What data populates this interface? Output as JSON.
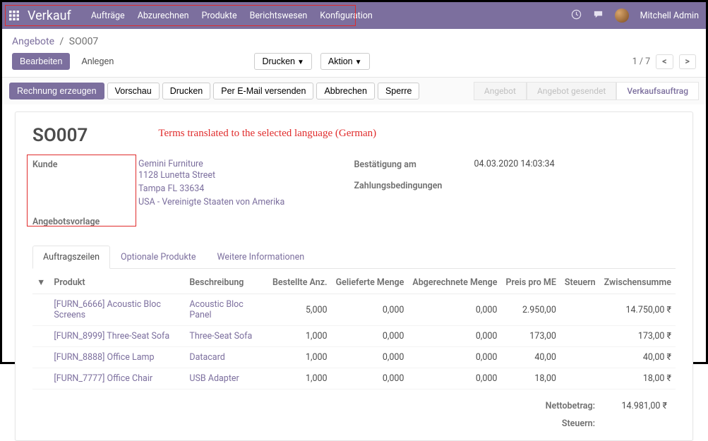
{
  "topbar": {
    "brand": "Verkauf",
    "nav": [
      "Aufträge",
      "Abzurechnen",
      "Produkte",
      "Berichtswesen",
      "Konfiguration"
    ],
    "user": "Mitchell Admin"
  },
  "breadcrumb": {
    "parent": "Angebote",
    "current": "SO007"
  },
  "toolbar": {
    "edit": "Bearbeiten",
    "create": "Anlegen",
    "print": "Drucken",
    "action": "Aktion",
    "pager": "1 / 7"
  },
  "statusbar": {
    "create_invoice": "Rechnung erzeugen",
    "preview": "Vorschau",
    "print": "Drucken",
    "send_email": "Per E-Mail versenden",
    "cancel": "Abbrechen",
    "lock": "Sperre",
    "stages": [
      "Angebot",
      "Angebot gesendet",
      "Verkaufsauftrag"
    ]
  },
  "annotation": "Terms translated to the selected language (German)",
  "record": {
    "name": "SO007",
    "labels": {
      "customer": "Kunde",
      "template": "Angebotsvorlage",
      "confirm_date": "Bestätigung am",
      "payment_terms": "Zahlungsbedingungen"
    },
    "customer": {
      "name": "Gemini Furniture",
      "street": "1128 Lunetta Street",
      "city": "Tampa FL 33634",
      "country": "USA - Vereinigte Staaten von Amerika"
    },
    "confirm_date": "04.03.2020 14:03:34"
  },
  "tabs": [
    "Auftragszeilen",
    "Optionale Produkte",
    "Weitere Informationen"
  ],
  "table": {
    "headers": {
      "product": "Produkt",
      "description": "Beschreibung",
      "ordered": "Bestellte Anz.",
      "delivered": "Gelieferte Menge",
      "invoiced": "Abgerechnete Menge",
      "unit_price": "Preis pro ME",
      "taxes": "Steuern",
      "subtotal": "Zwischensumme"
    },
    "rows": [
      {
        "product": "[FURN_6666] Acoustic Bloc Screens",
        "desc": "Acoustic Bloc Panel",
        "ordered": "5,000",
        "delivered": "0,000",
        "invoiced": "0,000",
        "price": "2.950,00",
        "subtotal": "14.750,00 ₹"
      },
      {
        "product": "[FURN_8999] Three-Seat Sofa",
        "desc": "Three-Seat Sofa",
        "ordered": "1,000",
        "delivered": "0,000",
        "invoiced": "0,000",
        "price": "173,00",
        "subtotal": "173,00 ₹"
      },
      {
        "product": "[FURN_8888] Office Lamp",
        "desc": "Datacard",
        "ordered": "1,000",
        "delivered": "0,000",
        "invoiced": "0,000",
        "price": "40,00",
        "subtotal": "40,00 ₹"
      },
      {
        "product": "[FURN_7777] Office Chair",
        "desc": "USB Adapter",
        "ordered": "1,000",
        "delivered": "0,000",
        "invoiced": "0,000",
        "price": "18,00",
        "subtotal": "18,00 ₹"
      }
    ]
  },
  "totals": {
    "net_label": "Nettobetrag:",
    "net_value": "14.981,00 ₹",
    "tax_label": "Steuern:"
  }
}
